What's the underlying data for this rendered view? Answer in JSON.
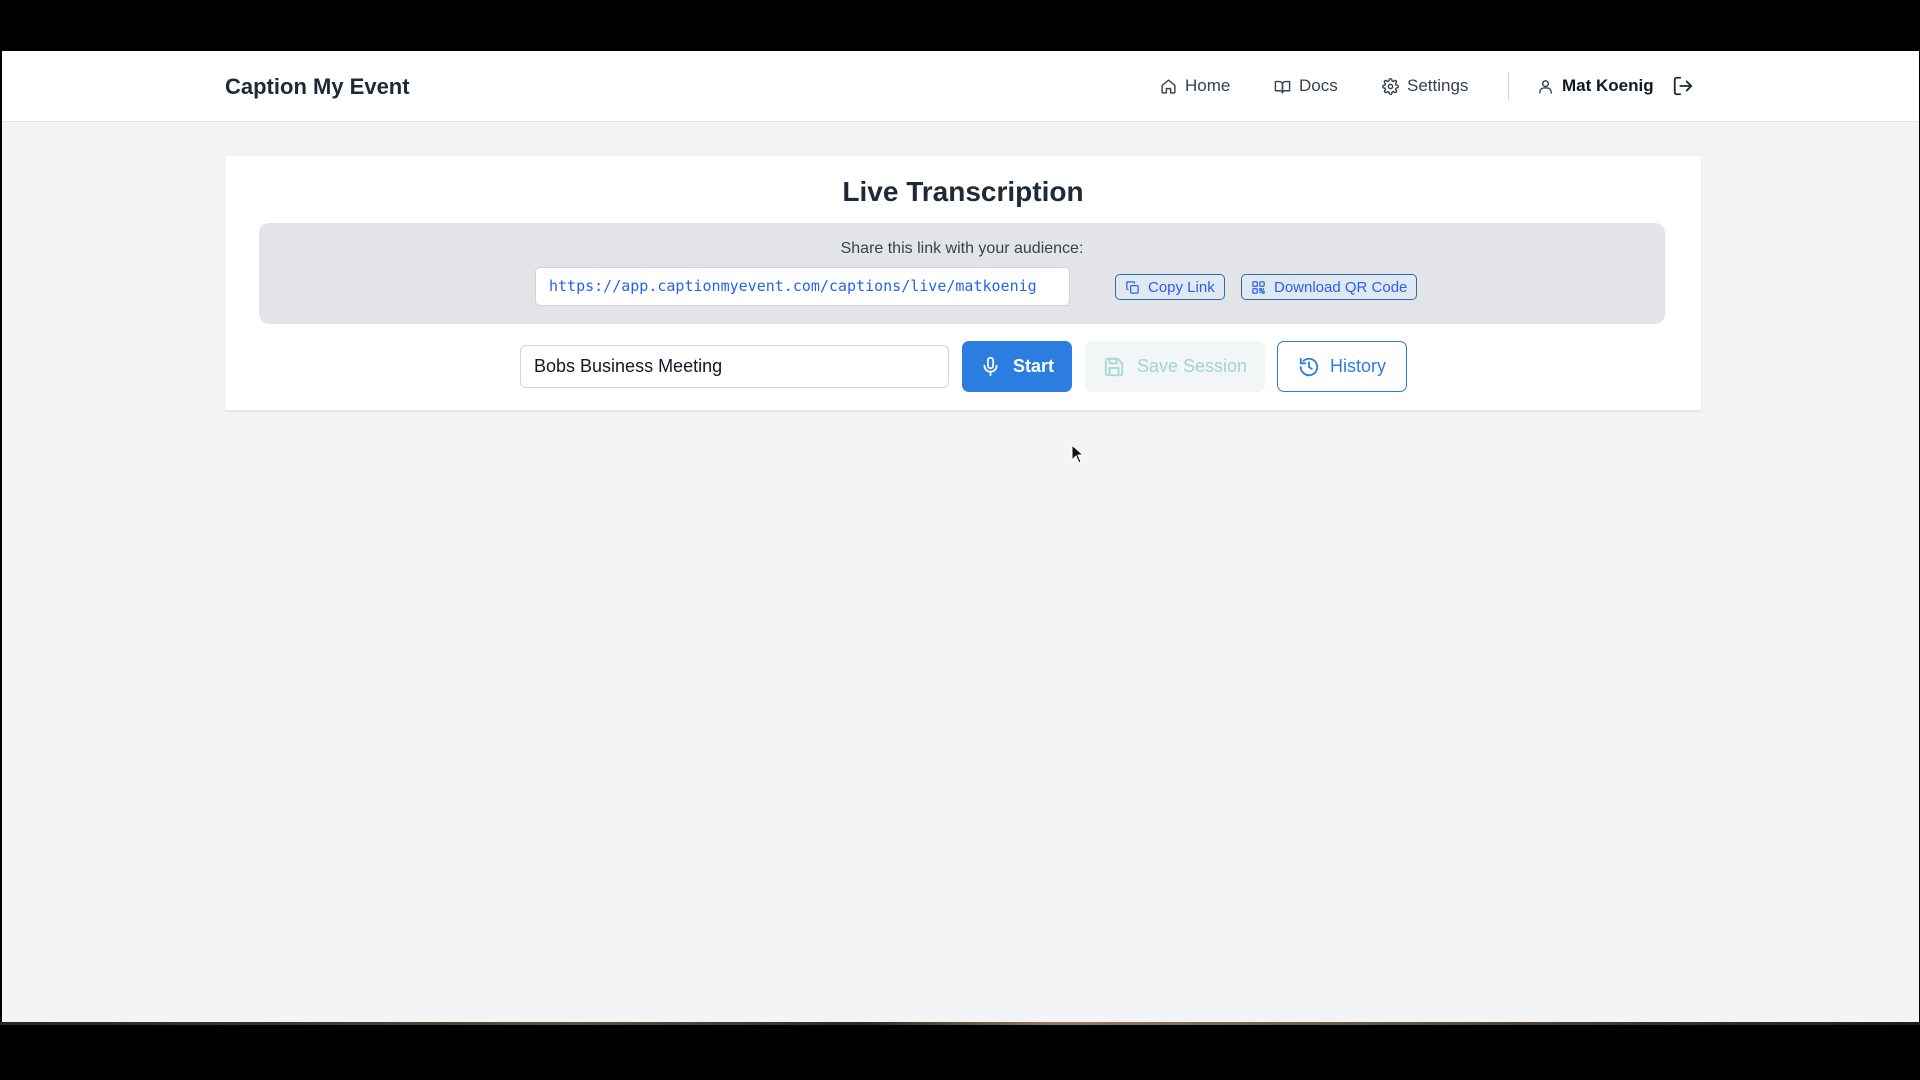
{
  "header": {
    "brand": "Caption My Event",
    "nav": {
      "home": "Home",
      "docs": "Docs",
      "settings": "Settings"
    },
    "user_name": "Mat Koenig"
  },
  "main": {
    "title": "Live Transcription",
    "share": {
      "label": "Share this link with your audience:",
      "link": "https://app.captionmyevent.com/captions/live/matkoenig",
      "copy_label": "Copy Link",
      "qr_label": "Download QR Code"
    },
    "session": {
      "name_value": "Bobs Business Meeting",
      "start_label": "Start",
      "save_label": "Save Session",
      "history_label": "History"
    }
  },
  "colors": {
    "primary": "#2b7de0",
    "save_disabled_text": "#9fd6cf",
    "page_bg": "#f3f4f6",
    "share_panel_bg": "#e2e4e8"
  },
  "icons": {
    "home": "home-icon",
    "docs": "book-icon",
    "settings": "gear-icon",
    "user": "user-icon",
    "logout": "logout-icon",
    "copy": "copy-icon",
    "qr": "qr-code-icon",
    "start": "microphone-icon",
    "save": "save-icon",
    "history": "history-icon"
  }
}
